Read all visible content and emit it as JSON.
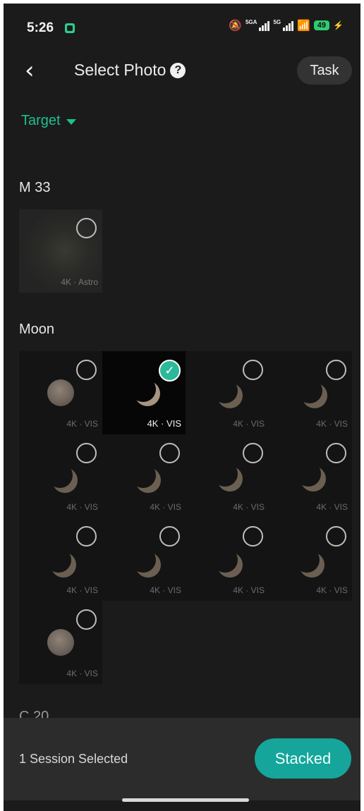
{
  "status_bar": {
    "time": "5:26",
    "signal1_label": "5GA",
    "signal2_label": "5G",
    "battery": "49",
    "accent_color": "#2ecc71"
  },
  "header": {
    "title": "Select Photo",
    "help_icon_text": "?",
    "task_label": "Task"
  },
  "filter": {
    "label": "Target"
  },
  "sections": [
    {
      "title": "M 33",
      "photos": [
        {
          "label": "4K · Astro",
          "selected": false
        }
      ]
    },
    {
      "title": "Moon",
      "photos": [
        {
          "label": "4K · VIS",
          "selected": false
        },
        {
          "label": "4K · VIS",
          "selected": true
        },
        {
          "label": "4K · VIS",
          "selected": false
        },
        {
          "label": "4K · VIS",
          "selected": false
        },
        {
          "label": "4K · VIS",
          "selected": false
        },
        {
          "label": "4K · VIS",
          "selected": false
        },
        {
          "label": "4K · VIS",
          "selected": false
        },
        {
          "label": "4K · VIS",
          "selected": false
        },
        {
          "label": "4K · VIS",
          "selected": false
        },
        {
          "label": "4K · VIS",
          "selected": false
        },
        {
          "label": "4K · VIS",
          "selected": false
        },
        {
          "label": "4K · VIS",
          "selected": false
        },
        {
          "label": "4K · VIS",
          "selected": false
        }
      ]
    },
    {
      "title": "C 20"
    }
  ],
  "bottom_bar": {
    "selection_text": "1 Session Selected",
    "stack_button": "Stacked",
    "button_color": "#16a59b"
  }
}
